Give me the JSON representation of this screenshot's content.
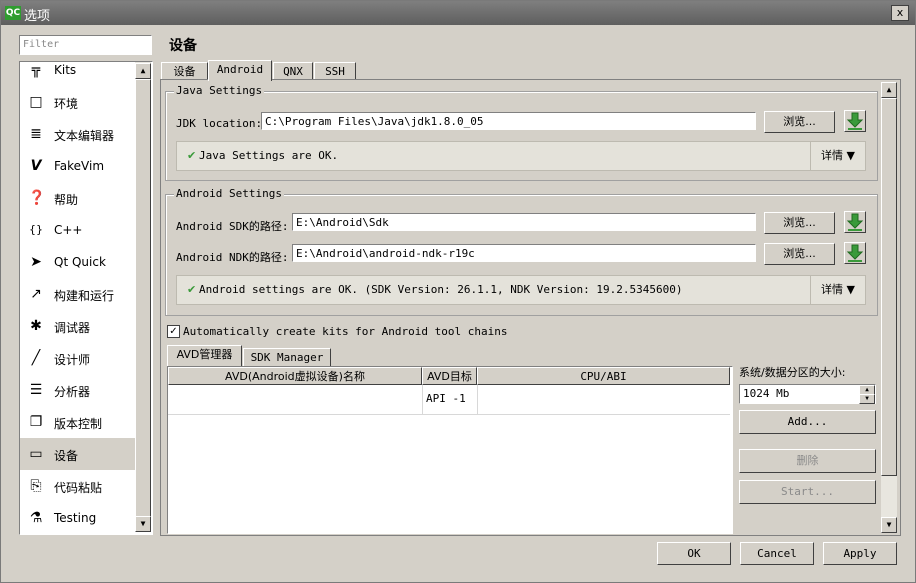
{
  "titlebar": {
    "app_icon": "QC",
    "title": "选项",
    "close": "x"
  },
  "filter": {
    "placeholder": "Filter"
  },
  "sidebar": {
    "items": [
      {
        "icon": "kits-icon",
        "glyph": "╦",
        "label": "Kits"
      },
      {
        "icon": "monitor-icon",
        "glyph": "□",
        "label": "环境"
      },
      {
        "icon": "text-editor-icon",
        "glyph": "≣",
        "label": "文本编辑器"
      },
      {
        "icon": "fakevim-icon",
        "glyph": "V",
        "label": "FakeVim"
      },
      {
        "icon": "help-icon",
        "glyph": "❓",
        "label": "帮助"
      },
      {
        "icon": "cpp-braces-icon",
        "glyph": "{}",
        "label": "C++"
      },
      {
        "icon": "qt-quick-icon",
        "glyph": "➤",
        "label": "Qt Quick"
      },
      {
        "icon": "hammer-icon",
        "glyph": "↗",
        "label": "构建和运行"
      },
      {
        "icon": "bug-icon",
        "glyph": "✱",
        "label": "调试器"
      },
      {
        "icon": "pen-icon",
        "glyph": "╱",
        "label": "设计师"
      },
      {
        "icon": "analyzer-icon",
        "glyph": "☰",
        "label": "分析器"
      },
      {
        "icon": "version-control-icon",
        "glyph": "❐",
        "label": "版本控制"
      },
      {
        "icon": "devices-icon",
        "glyph": "▭",
        "label": "设备",
        "selected": true
      },
      {
        "icon": "paste-icon",
        "glyph": "⎘",
        "label": "代码粘贴"
      },
      {
        "icon": "testing-icon",
        "glyph": "⚗",
        "label": "Testing"
      }
    ]
  },
  "page": {
    "title": "设备",
    "tabs": [
      {
        "label": "设备"
      },
      {
        "label": "Android",
        "active": true
      },
      {
        "label": "QNX"
      },
      {
        "label": "SSH"
      }
    ]
  },
  "java": {
    "group_title": "Java Settings",
    "jdk_label": "JDK location:",
    "jdk_value": "C:\\Program Files\\Java\\jdk1.8.0_05",
    "browse": "浏览...",
    "status": "Java Settings are OK.",
    "details": "详情 ▼"
  },
  "android": {
    "group_title": "Android Settings",
    "sdk_label": "Android SDK的路径:",
    "sdk_value": "E:\\Android\\Sdk",
    "ndk_label": "Android NDK的路径:",
    "ndk_value": "E:\\Android\\android-ndk-r19c",
    "browse": "浏览...",
    "status": "Android settings are OK.  (SDK Version: 26.1.1, NDK Version: 19.2.5345600)",
    "details": "详情 ▼"
  },
  "auto_kits": {
    "checked": true,
    "mark": "✓",
    "label": "Automatically create kits for Android tool chains"
  },
  "avd": {
    "tabs": [
      {
        "label": "AVD管理器",
        "active": true
      },
      {
        "label": "SDK Manager"
      }
    ],
    "columns": [
      "AVD(Android虚拟设备)名称",
      "AVD目标",
      "CPU/ABI"
    ],
    "rows": [
      {
        "name": "",
        "target": "API -1",
        "abi": ""
      }
    ],
    "partition_label": "系统/数据分区的大小:",
    "partition_value": "1024 Mb",
    "add": "Add...",
    "remove": "删除",
    "start": "Start..."
  },
  "dialog": {
    "ok": "OK",
    "cancel": "Cancel",
    "apply": "Apply"
  },
  "colors": {
    "download_green": "#3a9a3a",
    "check_green": "#3a9a3a",
    "selection": "#d4d0c8"
  }
}
